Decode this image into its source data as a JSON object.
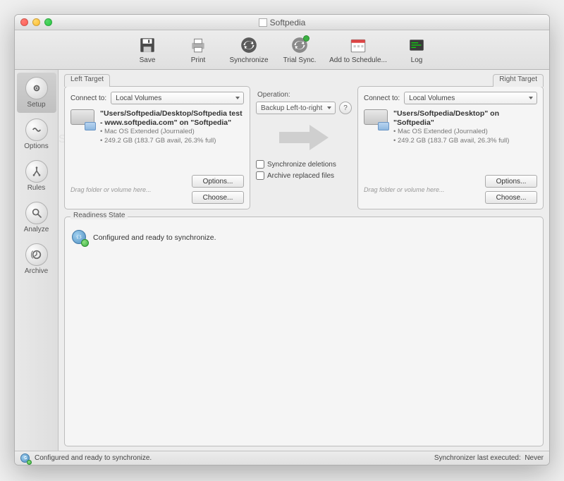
{
  "window": {
    "title": "Softpedia"
  },
  "toolbar": {
    "save": "Save",
    "print": "Print",
    "synchronize": "Synchronize",
    "trial_sync": "Trial Sync.",
    "add_schedule": "Add to Schedule...",
    "log": "Log"
  },
  "sidebar": {
    "setup": "Setup",
    "options": "Options",
    "rules": "Rules",
    "analyze": "Analyze",
    "archive": "Archive"
  },
  "left_target": {
    "tab": "Left Target",
    "connect_label": "Connect to:",
    "connect_value": "Local Volumes",
    "path_title": "\"Users/Softpedia/Desktop/Softpedia test - www.softpedia.com\" on \"Softpedia\"",
    "fs": "Mac OS Extended (Journaled)",
    "size": "249.2 GB (183.7 GB avail, 26.3% full)",
    "options_btn": "Options...",
    "choose_btn": "Choose...",
    "drag_hint": "Drag folder or volume here..."
  },
  "right_target": {
    "tab": "Right Target",
    "connect_label": "Connect to:",
    "connect_value": "Local Volumes",
    "path_title": "\"Users/Softpedia/Desktop\" on \"Softpedia\"",
    "fs": "Mac OS Extended (Journaled)",
    "size": "249.2 GB (183.7 GB avail, 26.3% full)",
    "options_btn": "Options...",
    "choose_btn": "Choose...",
    "drag_hint": "Drag folder or volume here..."
  },
  "operation": {
    "label": "Operation:",
    "value": "Backup Left-to-right",
    "sync_deletions": "Synchronize deletions",
    "archive_replaced": "Archive replaced files"
  },
  "readiness": {
    "group_label": "Readiness State",
    "message": "Configured and ready to synchronize."
  },
  "statusbar": {
    "left": "Configured and ready to synchronize.",
    "right_label": "Synchronizer last executed:",
    "right_value": "Never"
  }
}
